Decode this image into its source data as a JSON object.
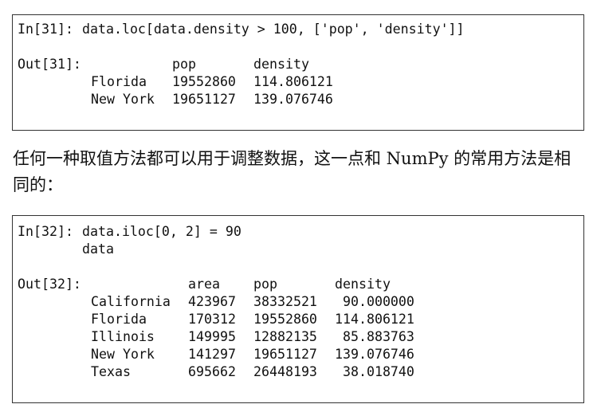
{
  "cell31": {
    "in_prompt": "In[31]:",
    "code": "data.loc[data.density > 100, ['pop', 'density']]",
    "out_prompt": "Out[31]:",
    "columns": [
      "pop",
      "density"
    ],
    "rows": [
      {
        "index": "Florida",
        "values": [
          "19552860",
          "114.806121"
        ]
      },
      {
        "index": "New York",
        "values": [
          "19651127",
          "139.076746"
        ]
      }
    ]
  },
  "paragraph": "任何一种取值方法都可以用于调整数据，这一点和 NumPy 的常用方法是相同的：",
  "cell32": {
    "in_prompt": "In[32]:",
    "code_line1": "data.iloc[0, 2] = 90",
    "code_line2": "data",
    "out_prompt": "Out[32]:",
    "columns": [
      "area",
      "pop",
      "density"
    ],
    "rows": [
      {
        "index": "California",
        "values": [
          "423967",
          "38332521",
          " 90.000000"
        ]
      },
      {
        "index": "Florida",
        "values": [
          "170312",
          "19552860",
          "114.806121"
        ]
      },
      {
        "index": "Illinois",
        "values": [
          "149995",
          "12882135",
          " 85.883763"
        ]
      },
      {
        "index": "New York",
        "values": [
          "141297",
          "19651127",
          "139.076746"
        ]
      },
      {
        "index": "Texas",
        "values": [
          "695662",
          "26448193",
          " 38.018740"
        ]
      }
    ]
  }
}
